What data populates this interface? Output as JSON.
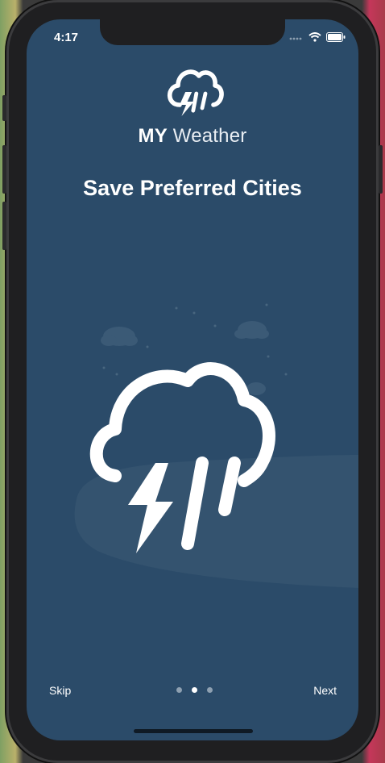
{
  "status_bar": {
    "time": "4:17",
    "icons": [
      "signal-icon",
      "wifi-icon",
      "battery-icon"
    ]
  },
  "logo": {
    "brand_bold": "MY",
    "brand_light": "Weather",
    "icon": "storm-cloud-icon"
  },
  "onboarding": {
    "title": "Save Preferred Cities",
    "illustration": "storm-cloud-icon",
    "page_indicator": {
      "count": 3,
      "active_index": 1
    }
  },
  "footer": {
    "skip_label": "Skip",
    "next_label": "Next"
  },
  "colors": {
    "screen_bg": "#2b4b69",
    "foreground": "#ffffff"
  }
}
